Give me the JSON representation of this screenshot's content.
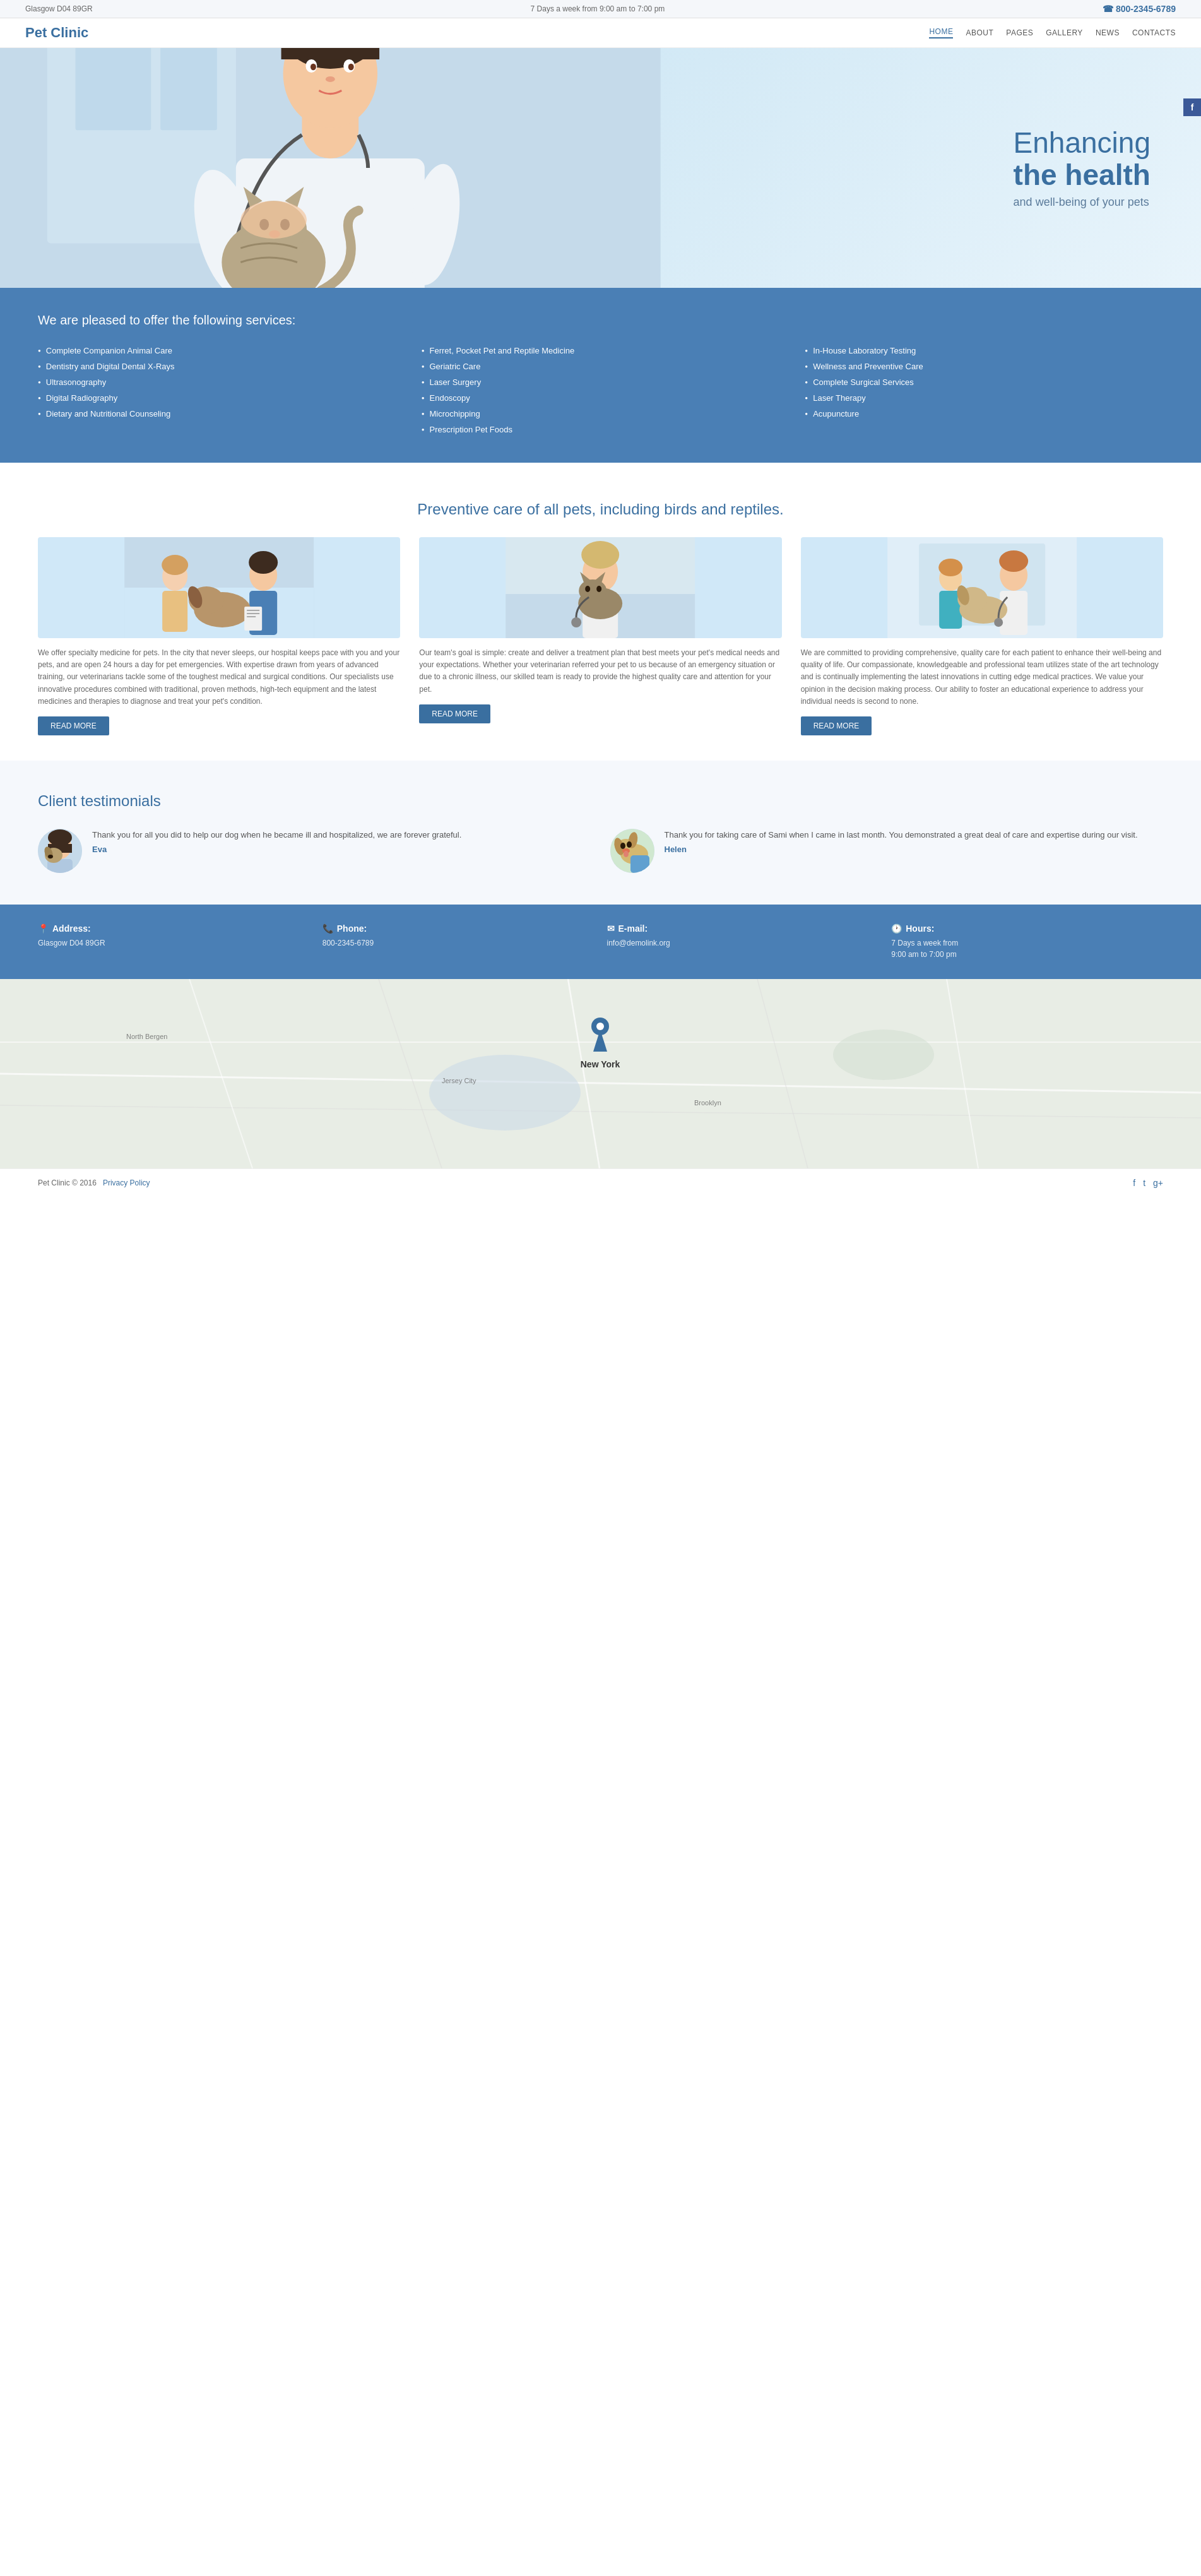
{
  "topbar": {
    "location": "Glasgow D04 89GR",
    "hours": "7 Days a week from 9:00 am to 7:00 pm",
    "phone": "800-2345-6789"
  },
  "header": {
    "logo": "Pet Clinic",
    "nav": [
      {
        "label": "HOME",
        "active": true
      },
      {
        "label": "ABOUT",
        "active": false
      },
      {
        "label": "PAGES",
        "active": false
      },
      {
        "label": "GALLERY",
        "active": false
      },
      {
        "label": "NEWS",
        "active": false
      },
      {
        "label": "CONTACTS",
        "active": false
      }
    ]
  },
  "hero": {
    "line1": "Enhancing",
    "line2": "the health",
    "line3": "and well-being of your pets"
  },
  "services": {
    "heading": "We are pleased to offer the following services:",
    "col1": [
      "Complete Companion Animal Care",
      "Dentistry and Digital Dental X-Rays",
      "Ultrasonography",
      "Digital Radiography",
      "Dietary and Nutritional Counseling"
    ],
    "col2": [
      "Ferret, Pocket Pet and Reptile Medicine",
      "Geriatric Care",
      "Laser Surgery",
      "Endoscopy",
      "Microchipping",
      "Prescription Pet Foods"
    ],
    "col3": [
      "In-House Laboratory Testing",
      "Wellness and Preventive Care",
      "Complete Surgical Services",
      "Laser Therapy",
      "Acupuncture"
    ]
  },
  "preventive": {
    "heading": "Preventive care of all pets, including birds and reptiles.",
    "cards": [
      {
        "text": "We offer specialty medicine for pets. In the city that never sleeps, our hospital keeps pace with you and your pets, and are open 24 hours a day for pet emergencies. With expertise drawn from years of advanced training, our veterinarians tackle some of the toughest medical and surgical conditions. Our specialists use innovative procedures combined with traditional, proven methods, high-tech equipment and the latest medicines and therapies to diagnose and treat your pet's condition.",
        "btn": "READ MORE"
      },
      {
        "text": "Our team's goal is simple: create and deliver a treatment plan that best meets your pet's medical needs and your expectations. Whether your veterinarian referred your pet to us because of an emergency situation or due to a chronic illness, our skilled team is ready to provide the highest quality care and attention for your pet.",
        "btn": "READ MORE"
      },
      {
        "text": "We are committed to providing comprehensive, quality care for each patient to enhance their well-being and quality of life. Our compassionate, knowledgeable and professional team utilizes state of the art technology and is continually implementing the latest innovations in cutting edge medical practices. We value your opinion in the decision making process. Our ability to foster an educational experience to address your individual needs is second to none.",
        "btn": "READ MORE"
      }
    ]
  },
  "testimonials": {
    "heading": "Client testimonials",
    "items": [
      {
        "text": "Thank you for all you did to help our dog when he became ill and hospitalized, we are forever grateful.",
        "name": "Eva"
      },
      {
        "text": "Thank you for taking care of Sami when I came in last month. You demonstrated a great deal of care and expertise during our visit.",
        "name": "Helen"
      }
    ]
  },
  "contact_footer": {
    "address_label": "Address:",
    "address_value": "Glasgow D04 89GR",
    "phone_label": "Phone:",
    "phone_value": "800-2345-6789",
    "email_label": "E-mail:",
    "email_value": "info@demolink.org",
    "hours_label": "Hours:",
    "hours_value": "7 Days a week from\n9:00 am to 7:00 pm"
  },
  "map": {
    "label": "New York"
  },
  "bottom_footer": {
    "copyright": "Pet Clinic © 2016  Privacy Policy",
    "social": [
      "f",
      "t",
      "g+"
    ]
  }
}
